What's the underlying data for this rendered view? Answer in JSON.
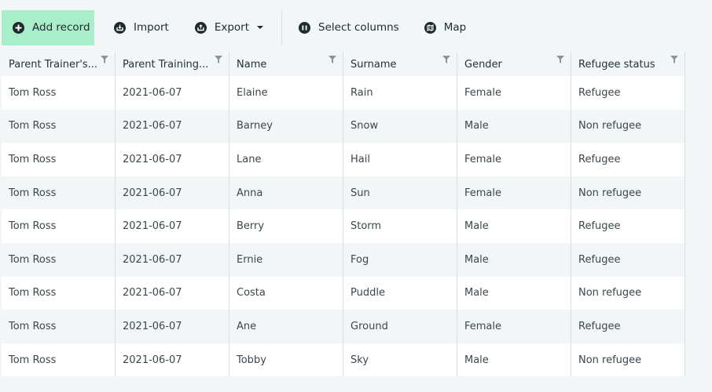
{
  "toolbar": {
    "add_record": {
      "label": "Add record",
      "icon": "plus-circle-icon"
    },
    "import": {
      "label": "Import",
      "icon": "import-icon"
    },
    "export": {
      "label": "Export",
      "icon": "export-icon",
      "dropdown": true
    },
    "select_columns": {
      "label": "Select columns",
      "icon": "columns-icon"
    },
    "map": {
      "label": "Map",
      "icon": "map-icon"
    }
  },
  "colors": {
    "primary_button_bg": "#a9edcb",
    "page_bg": "#f3f6f7",
    "text": "#1e2a2e"
  },
  "table": {
    "columns": [
      {
        "label": "Parent Trainer's..."
      },
      {
        "label": "Parent Training..."
      },
      {
        "label": "Name"
      },
      {
        "label": "Surname"
      },
      {
        "label": "Gender"
      },
      {
        "label": "Refugee status"
      }
    ],
    "rows": [
      [
        "Tom Ross",
        "2021-06-07",
        "Elaine",
        "Rain",
        "Female",
        "Refugee"
      ],
      [
        "Tom Ross",
        "2021-06-07",
        "Barney",
        "Snow",
        "Male",
        "Non refugee"
      ],
      [
        "Tom Ross",
        "2021-06-07",
        "Lane",
        "Hail",
        "Female",
        "Refugee"
      ],
      [
        "Tom Ross",
        "2021-06-07",
        "Anna",
        "Sun",
        "Female",
        "Non refugee"
      ],
      [
        "Tom Ross",
        "2021-06-07",
        "Berry",
        "Storm",
        "Male",
        "Refugee"
      ],
      [
        "Tom Ross",
        "2021-06-07",
        "Ernie",
        "Fog",
        "Male",
        "Refugee"
      ],
      [
        "Tom Ross",
        "2021-06-07",
        "Costa",
        "Puddle",
        "Male",
        "Non refugee"
      ],
      [
        "Tom Ross",
        "2021-06-07",
        "Ane",
        "Ground",
        "Female",
        "Refugee"
      ],
      [
        "Tom Ross",
        "2021-06-07",
        "Tobby",
        "Sky",
        "Male",
        "Non refugee"
      ]
    ]
  }
}
